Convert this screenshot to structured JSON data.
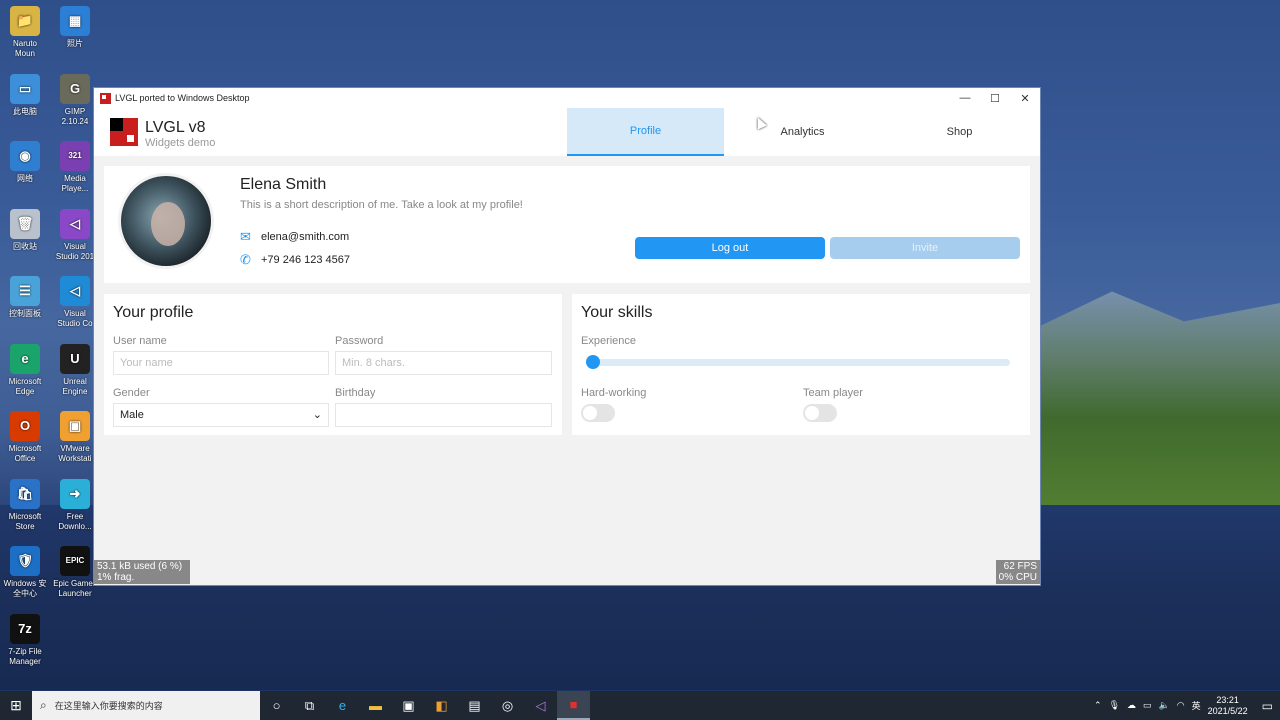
{
  "desktop": {
    "icons": [
      {
        "label": "Naruto\nMoun",
        "icon": "folder-icon",
        "color": "#d8b445",
        "glyph": "📁"
      },
      {
        "label": "照片",
        "icon": "photos-icon",
        "color": "#2b7fd4",
        "glyph": "▦"
      },
      {
        "label": "此电脑",
        "icon": "computer-icon",
        "color": "#3c8fd8",
        "glyph": "▭"
      },
      {
        "label": "GIMP\n2.10.24",
        "icon": "gimp-icon",
        "color": "#6a6a5a",
        "glyph": "G"
      },
      {
        "label": "网络",
        "icon": "network-icon",
        "color": "#2f7ed0",
        "glyph": "◉"
      },
      {
        "label": "Media\nPlaye...",
        "icon": "media-player-icon",
        "color": "#7a3fb0",
        "glyph": "321"
      },
      {
        "label": "回收站",
        "icon": "recycle-bin-icon",
        "color": "#b9c2cc",
        "glyph": "🗑"
      },
      {
        "label": "Visual\nStudio 201",
        "icon": "visual-studio-icon",
        "color": "#8a48c8",
        "glyph": "◁"
      },
      {
        "label": "控制面板",
        "icon": "control-panel-icon",
        "color": "#4aa3d8",
        "glyph": "☰"
      },
      {
        "label": "Visual\nStudio Co",
        "icon": "vscode-icon",
        "color": "#1f8ad6",
        "glyph": "◁"
      },
      {
        "label": "Microsoft\nEdge",
        "icon": "edge-icon",
        "color": "#1aa36a",
        "glyph": "e"
      },
      {
        "label": "Unreal\nEngine",
        "icon": "unreal-icon",
        "color": "#222222",
        "glyph": "U"
      },
      {
        "label": "Microsoft\nOffice",
        "icon": "office-icon",
        "color": "#d83b01",
        "glyph": "O"
      },
      {
        "label": "VMware\nWorkstati",
        "icon": "vmware-icon",
        "color": "#f0a030",
        "glyph": "▣"
      },
      {
        "label": "Microsoft\nStore",
        "icon": "store-icon",
        "color": "#2a72c8",
        "glyph": "🛍"
      },
      {
        "label": "Free\nDownlo...",
        "icon": "download-icon",
        "color": "#2ab0d8",
        "glyph": "➜"
      },
      {
        "label": "Windows 安\n全中心",
        "icon": "security-icon",
        "color": "#1c6fc4",
        "glyph": "🛡"
      },
      {
        "label": "Epic Games\nLauncher",
        "icon": "epic-games-icon",
        "color": "#111111",
        "glyph": "EPIC"
      },
      {
        "label": "7-Zip File\nManager",
        "icon": "7zip-icon",
        "color": "#111111",
        "glyph": "7z"
      }
    ]
  },
  "window": {
    "title": "LVGL ported to Windows Desktop",
    "minimize": "—",
    "maximize": "☐",
    "close": "✕"
  },
  "app": {
    "title": "LVGL v8",
    "subtitle": "Widgets demo",
    "tabs": [
      {
        "label": "Profile",
        "active": true
      },
      {
        "label": "Analytics",
        "active": false
      },
      {
        "label": "Shop",
        "active": false
      }
    ]
  },
  "profile": {
    "name": "Elena Smith",
    "description": "This is a short description of me. Take a look at my profile!",
    "email": "elena@smith.com",
    "phone": "+79 246 123 4567",
    "logout_label": "Log out",
    "invite_label": "Invite"
  },
  "your_profile": {
    "title": "Your profile",
    "username_label": "User name",
    "username_placeholder": "Your name",
    "password_label": "Password",
    "password_placeholder": "Min. 8 chars.",
    "gender_label": "Gender",
    "gender_value": "Male",
    "birthday_label": "Birthday",
    "birthday_value": ""
  },
  "your_skills": {
    "title": "Your skills",
    "experience_label": "Experience",
    "experience_value": 0,
    "hardworking_label": "Hard-working",
    "hardworking_on": false,
    "teamplayer_label": "Team player",
    "teamplayer_on": false
  },
  "stats": {
    "memory_line1": "53.1 kB used (6 %)",
    "memory_line2": "1% frag.",
    "fps": "62 FPS",
    "cpu": "0% CPU"
  },
  "taskbar": {
    "search_placeholder": "在这里输入你要搜索的内容",
    "tray_lang": "英",
    "time": "23:21",
    "date": "2021/5/22"
  },
  "colors": {
    "accent": "#2196f3",
    "accent_light": "#d5e9f8",
    "brand_red": "#c81e1e"
  }
}
